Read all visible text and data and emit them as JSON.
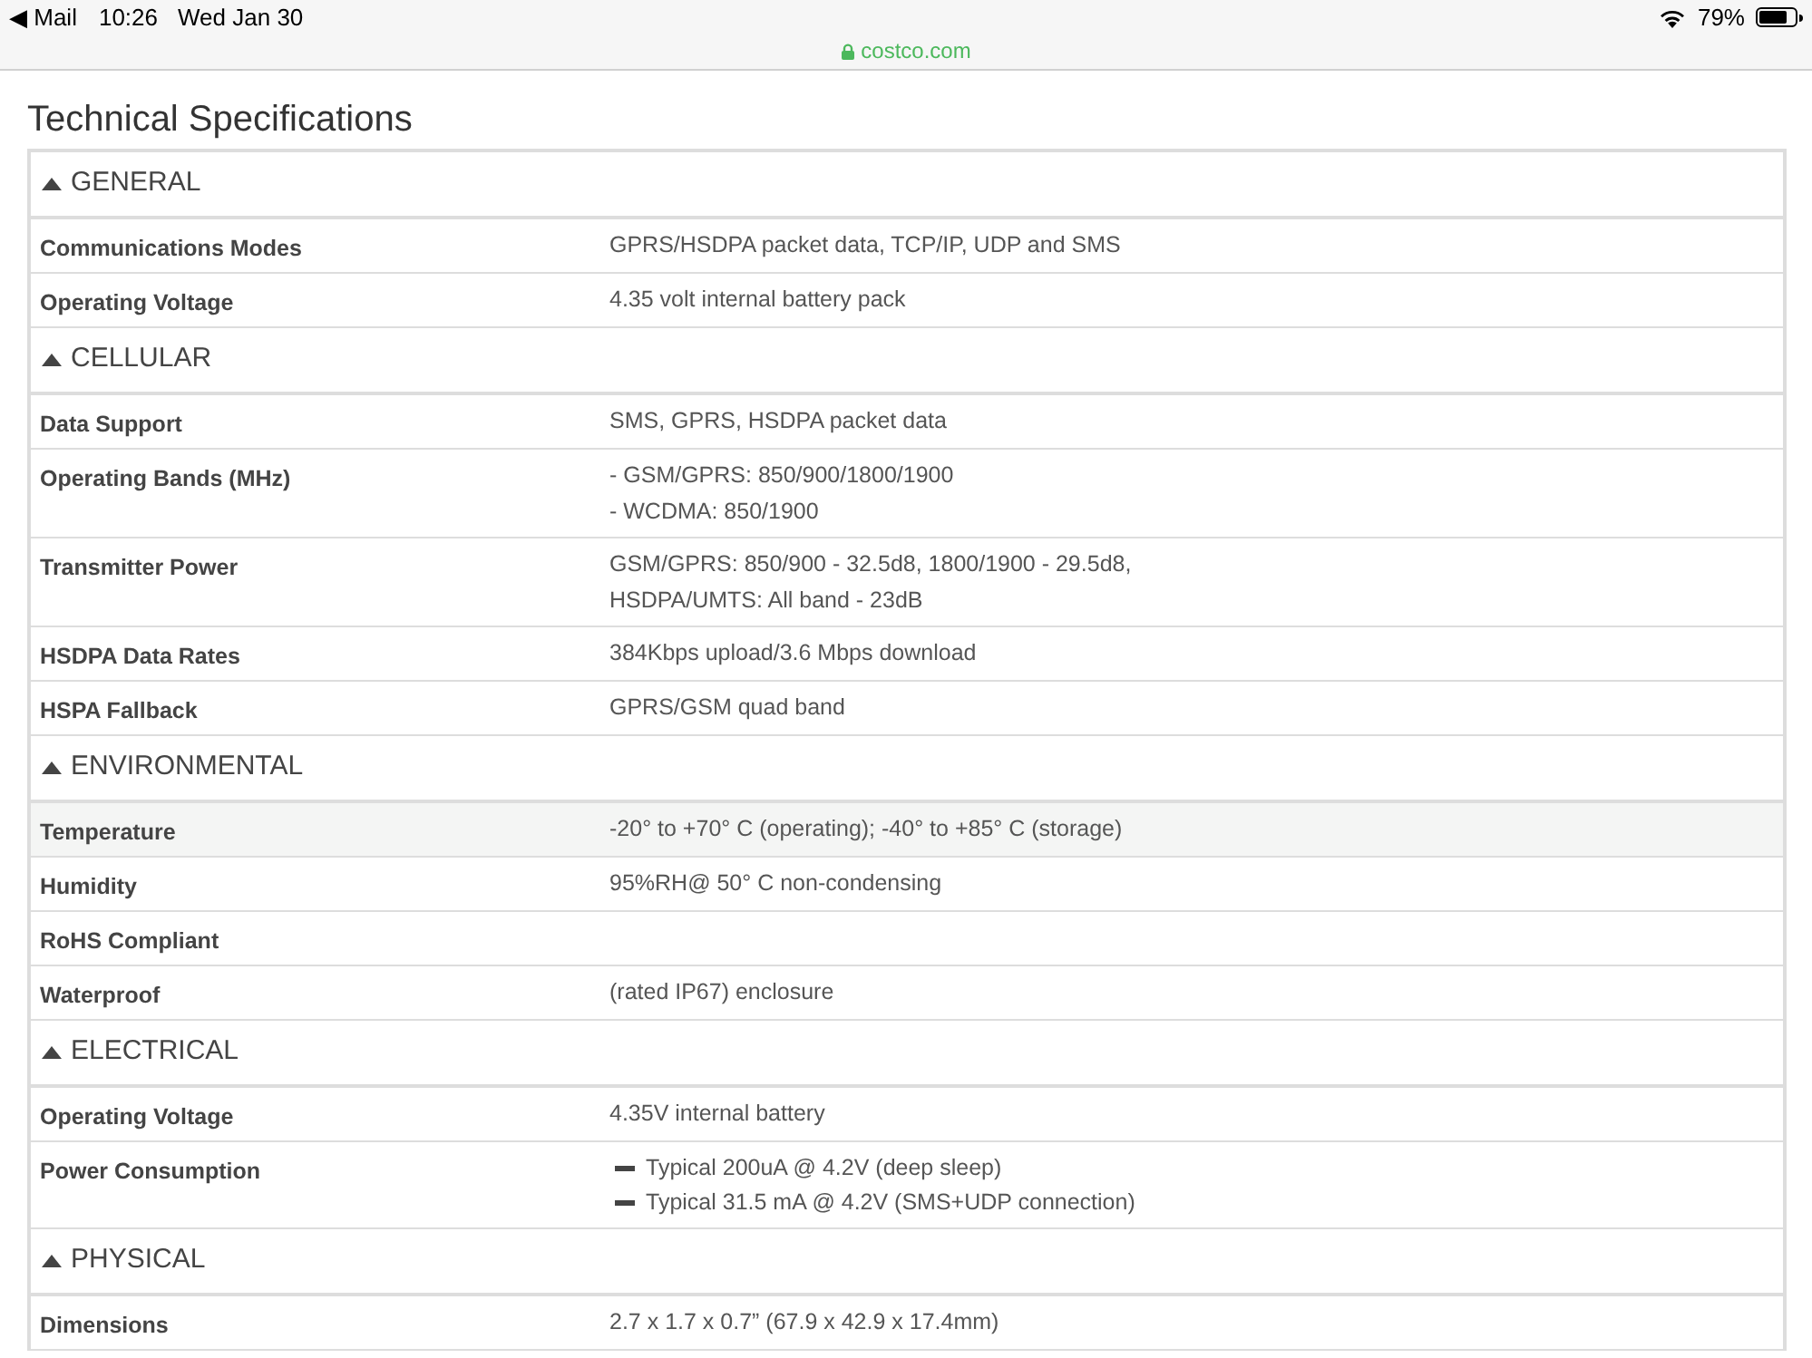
{
  "status_bar": {
    "back_icon": "◀",
    "back_app": "Mail",
    "time": "10:26",
    "date": "Wed Jan 30",
    "url": "costco.com",
    "battery": "79%"
  },
  "title": "Technical Specifications",
  "sections": [
    {
      "heading": "GENERAL",
      "expanded": true,
      "rows": [
        {
          "label": "Communications Modes",
          "kind": "text",
          "lines": [
            "GPRS/HSDPA packet data, TCP/IP, UDP and SMS"
          ],
          "highlighted": false
        },
        {
          "label": "Operating Voltage",
          "kind": "text",
          "lines": [
            "4.35 volt internal battery pack"
          ],
          "highlighted": false
        }
      ]
    },
    {
      "heading": "CELLULAR",
      "expanded": true,
      "rows": [
        {
          "label": "Data Support",
          "kind": "text",
          "lines": [
            "SMS, GPRS, HSDPA packet data"
          ],
          "highlighted": false
        },
        {
          "label": "Operating Bands (MHz)",
          "kind": "text",
          "lines": [
            "- GSM/GPRS: 850/900/1800/1900",
            "- WCDMA: 850/1900"
          ],
          "highlighted": false
        },
        {
          "label": "Transmitter Power",
          "kind": "text",
          "lines": [
            "GSM/GPRS: 850/900 - 32.5d8, 1800/1900 - 29.5d8,",
            "HSDPA/UMTS: All band - 23dB"
          ],
          "highlighted": false
        },
        {
          "label": "HSDPA Data Rates",
          "kind": "text",
          "lines": [
            "384Kbps upload/3.6 Mbps download"
          ],
          "highlighted": false
        },
        {
          "label": "HSPA Fallback",
          "kind": "text",
          "lines": [
            "GPRS/GSM quad band"
          ],
          "highlighted": false
        }
      ]
    },
    {
      "heading": "ENVIRONMENTAL",
      "expanded": true,
      "rows": [
        {
          "label": "Temperature",
          "kind": "text",
          "lines": [
            "-20° to +70° C (operating); -40° to +85° C (storage)"
          ],
          "highlighted": true
        },
        {
          "label": "Humidity",
          "kind": "text",
          "lines": [
            "95%RH@ 50° C non-condensing"
          ],
          "highlighted": false
        },
        {
          "label": "RoHS Compliant",
          "kind": "text",
          "lines": [],
          "highlighted": false
        },
        {
          "label": "Waterproof",
          "kind": "text",
          "lines": [
            "(rated IP67) enclosure"
          ],
          "highlighted": false
        }
      ]
    },
    {
      "heading": "ELECTRICAL",
      "expanded": true,
      "rows": [
        {
          "label": "Operating Voltage",
          "kind": "text",
          "lines": [
            "4.35V internal battery"
          ],
          "highlighted": false
        },
        {
          "label": "Power Consumption",
          "kind": "bullets",
          "lines": [
            "Typical 200uA @ 4.2V (deep sleep)",
            "Typical 31.5 mA @ 4.2V (SMS+UDP connection)"
          ],
          "highlighted": false
        }
      ]
    },
    {
      "heading": "PHYSICAL",
      "expanded": true,
      "rows": [
        {
          "label": "Dimensions",
          "kind": "text",
          "lines": [
            "2.7 x 1.7 x 0.7” (67.9 x 42.9 x 17.4mm)"
          ],
          "highlighted": false
        }
      ]
    }
  ]
}
